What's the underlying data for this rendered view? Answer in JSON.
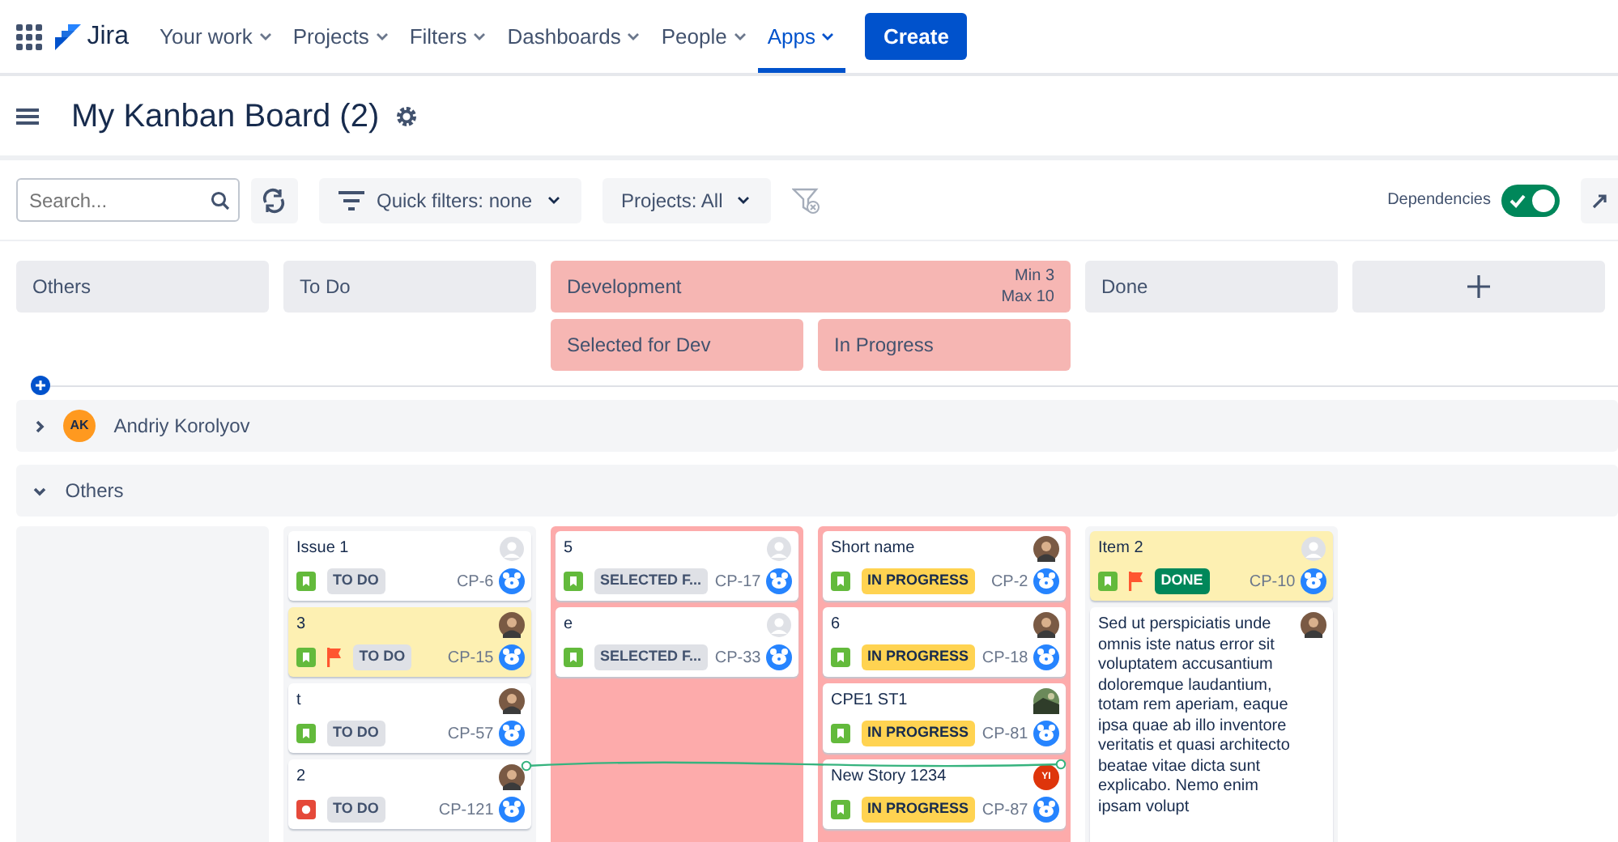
{
  "nav": {
    "product": "Jira",
    "items": [
      {
        "label": "Your work",
        "selected": false
      },
      {
        "label": "Projects",
        "selected": false
      },
      {
        "label": "Filters",
        "selected": false
      },
      {
        "label": "Dashboards",
        "selected": false
      },
      {
        "label": "People",
        "selected": false
      },
      {
        "label": "Apps",
        "selected": true
      }
    ],
    "create": "Create"
  },
  "board": {
    "title": "My Kanban Board (2)"
  },
  "toolbar": {
    "search": {
      "placeholder": "Search..."
    },
    "quick_filters": "Quick filters: none",
    "projects": "Projects: All",
    "dependencies": {
      "label": "Dependencies",
      "on": true
    }
  },
  "columns": [
    {
      "title": "Others",
      "over_limit": false
    },
    {
      "title": "To Do",
      "over_limit": false
    },
    {
      "title": "Development",
      "over_limit": true,
      "min": "Min 3",
      "max": "Max 10",
      "children": [
        {
          "title": "Selected for Dev"
        },
        {
          "title": "In Progress"
        }
      ]
    },
    {
      "title": "Done",
      "over_limit": false
    }
  ],
  "swimlanes": [
    {
      "name": "Andriy Korolyov",
      "initials": "AK",
      "expanded": false
    },
    {
      "name": "Others",
      "expanded": true,
      "cells": [
        [],
        [
          {
            "kind": "story",
            "title": "Issue 1",
            "flagged": false,
            "highlighted": false,
            "status": {
              "label": "TO DO",
              "color": "#dfe1e6"
            },
            "key": "CP-6",
            "avatar": {
              "kind": "empty"
            }
          },
          {
            "kind": "story",
            "title": "3",
            "flagged": true,
            "highlighted": true,
            "status": {
              "label": "TO DO",
              "color": "#dfe1e6"
            },
            "key": "CP-15",
            "avatar": {
              "kind": "photo"
            }
          },
          {
            "kind": "story",
            "title": "t",
            "flagged": false,
            "highlighted": false,
            "status": {
              "label": "TO DO",
              "color": "#dfe1e6"
            },
            "key": "CP-57",
            "avatar": {
              "kind": "photo"
            }
          },
          {
            "kind": "bug",
            "title": "2",
            "flagged": false,
            "highlighted": false,
            "status": {
              "label": "TO DO",
              "color": "#dfe1e6"
            },
            "key": "CP-121",
            "avatar": {
              "kind": "photo"
            },
            "link_start": true
          }
        ],
        [
          {
            "kind": "story",
            "title": "5",
            "flagged": false,
            "highlighted": false,
            "status": {
              "label": "SELECTED F...",
              "color": "#dfe1e6"
            },
            "key": "CP-17",
            "avatar": {
              "kind": "empty"
            }
          },
          {
            "kind": "story",
            "title": "e",
            "flagged": false,
            "highlighted": false,
            "status": {
              "label": "SELECTED F...",
              "color": "#dfe1e6"
            },
            "key": "CP-33",
            "avatar": {
              "kind": "empty"
            }
          }
        ],
        [
          {
            "kind": "story",
            "title": "Short name",
            "flagged": false,
            "highlighted": false,
            "status": {
              "label": "IN PROGRESS",
              "color": "#ffd351"
            },
            "key": "CP-2",
            "avatar": {
              "kind": "photo"
            }
          },
          {
            "kind": "story",
            "title": "6",
            "flagged": false,
            "highlighted": false,
            "status": {
              "label": "IN PROGRESS",
              "color": "#ffd351"
            },
            "key": "CP-18",
            "avatar": {
              "kind": "photo"
            }
          },
          {
            "kind": "story",
            "title": "CPE1 ST1",
            "flagged": false,
            "highlighted": false,
            "status": {
              "label": "IN PROGRESS",
              "color": "#ffd351"
            },
            "key": "CP-81",
            "avatar": {
              "kind": "landscape"
            }
          },
          {
            "kind": "story",
            "title": "New Story 1234",
            "flagged": false,
            "highlighted": false,
            "status": {
              "label": "IN PROGRESS",
              "color": "#ffd351"
            },
            "key": "CP-87",
            "avatar": {
              "kind": "initials",
              "initials": "YI"
            },
            "link_end": true
          }
        ],
        [
          {
            "kind": "story",
            "title": "Item 2",
            "flagged": true,
            "highlighted": true,
            "status": {
              "label": "DONE",
              "color": "#00875a"
            },
            "key": "CP-10",
            "avatar": {
              "kind": "empty"
            }
          },
          {
            "kind": "text",
            "title": "Sed ut perspiciatis unde omnis iste natus error sit voluptatem accusantium doloremque laudantium, totam rem aperiam, eaque ipsa quae ab illo inventore veritatis et quasi architecto beatae vitae dicta sunt explicabo. Nemo enim ipsam volupt",
            "highlighted": false,
            "avatar": {
              "kind": "photo"
            }
          }
        ]
      ]
    }
  ]
}
